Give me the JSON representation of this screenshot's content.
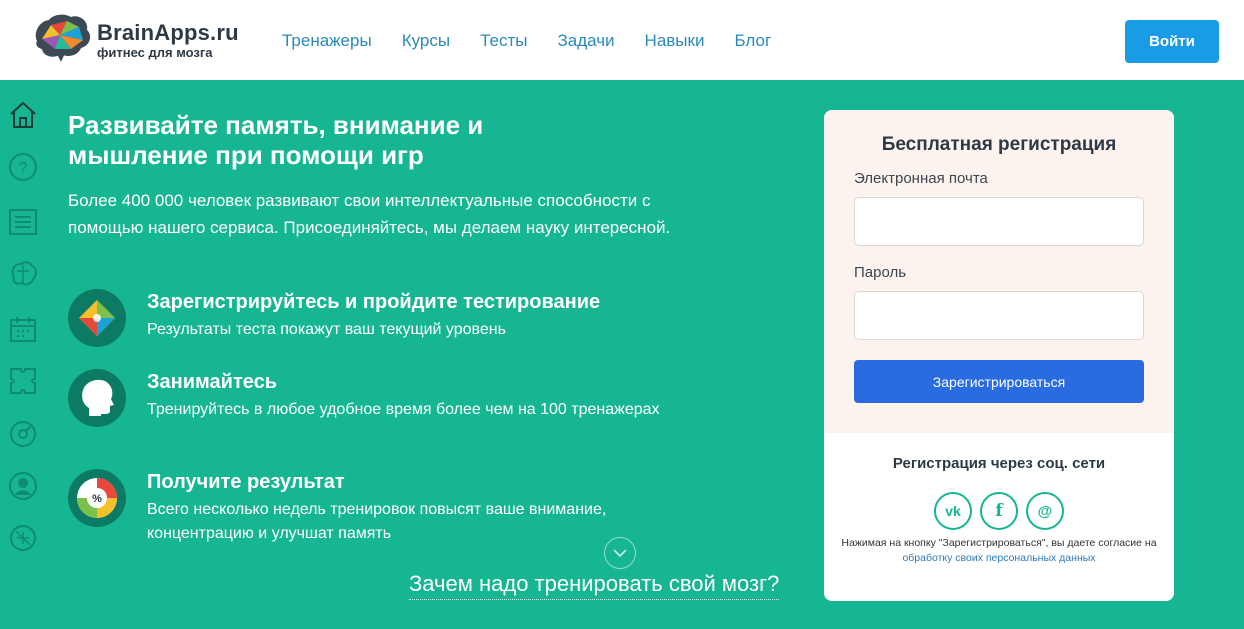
{
  "header": {
    "logo_title": "BrainApps.ru",
    "logo_subtitle": "фитнес для мозга",
    "nav": [
      "Тренажеры",
      "Курсы",
      "Тесты",
      "Задачи",
      "Навыки",
      "Блог"
    ],
    "login_label": "Войти"
  },
  "sidebar": {
    "icons": [
      "home-icon",
      "question-icon",
      "list-icon",
      "brain-icon",
      "calendar-icon",
      "puzzle-icon",
      "compass-icon",
      "profile-icon",
      "settings-icon"
    ]
  },
  "hero": {
    "title_line1": "Развивайте память, внимание и",
    "title_line2": "мышление при помощи игр",
    "description": "Более 400 000 человек развивают свои интеллектуальные способности с помощью нашего сервиса. Присоединяйтесь, мы делаем науку интересной."
  },
  "features": [
    {
      "title": "Зарегистрируйтесь и пройдите тестирование",
      "text": "Результаты теста покажут ваш текущий уровень",
      "icon": "puzzle-icon"
    },
    {
      "title": "Занимайтесь",
      "text": "Тренируйтесь в любое удобное время более чем на 100 тренажерах",
      "icon": "head-icon"
    },
    {
      "title": "Получите результат",
      "text": "Всего несколько недель тренировок повысят ваше внимание, концентрацию и улучшат память",
      "icon": "percent-chart-icon"
    }
  ],
  "why_link": "Зачем надо тренировать свой мозг?",
  "registration": {
    "title": "Бесплатная регистрация",
    "email_label": "Электронная почта",
    "email_value": "",
    "password_label": "Пароль",
    "password_value": "",
    "submit_label": "Зарегистрироваться",
    "social_title": "Регистрация через соц. сети",
    "socials": [
      {
        "name": "vk-icon",
        "glyph": "vk"
      },
      {
        "name": "facebook-icon",
        "glyph": "f"
      },
      {
        "name": "email-icon",
        "glyph": "@"
      }
    ],
    "consent_text": "Нажимая на кнопку \"Зарегистрироваться\", вы даете согласие на",
    "consent_link": "обработку своих персональных данных"
  },
  "colors": {
    "accent": "#16b693",
    "link": "#2a8ab8",
    "login": "#1a9be6",
    "register": "#2a6be0"
  }
}
